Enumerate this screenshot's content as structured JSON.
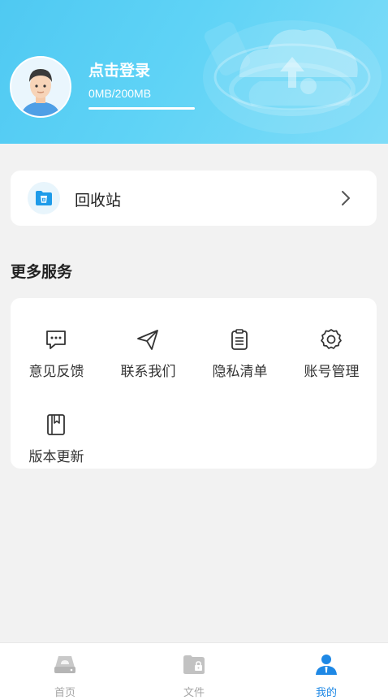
{
  "header": {
    "login_label": "点击登录",
    "storage_text": "0MB/200MB",
    "storage_used_fraction": 0.0
  },
  "recycle": {
    "label": "回收站",
    "icon": "trash-folder-icon"
  },
  "services": {
    "title": "更多服务",
    "items": [
      {
        "label": "意见反馈",
        "icon": "message-icon"
      },
      {
        "label": "联系我们",
        "icon": "send-icon"
      },
      {
        "label": "隐私清单",
        "icon": "clipboard-icon"
      },
      {
        "label": "账号管理",
        "icon": "gear-icon"
      },
      {
        "label": "版本更新",
        "icon": "book-icon"
      }
    ]
  },
  "tabbar": {
    "tabs": [
      {
        "label": "首页",
        "icon": "drive-icon",
        "active": false
      },
      {
        "label": "文件",
        "icon": "folder-lock-icon",
        "active": false
      },
      {
        "label": "我的",
        "icon": "person-icon",
        "active": true
      }
    ]
  },
  "colors": {
    "accent": "#1e88e5",
    "header_start": "#4fc9f2",
    "header_end": "#7fdcf8",
    "inactive_tab": "#a6a6a6"
  }
}
